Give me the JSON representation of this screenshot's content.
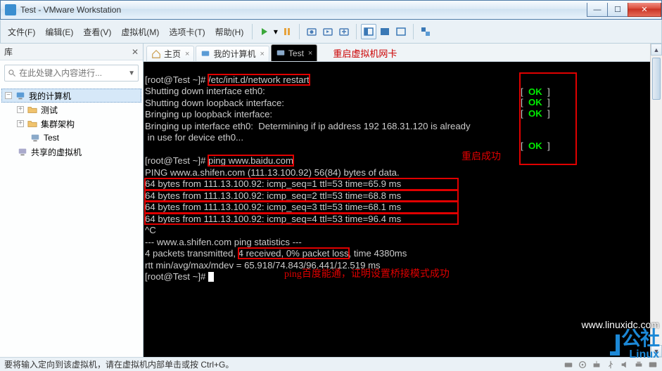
{
  "window": {
    "title": "Test - VMware Workstation"
  },
  "menu": {
    "file": "文件(F)",
    "edit": "编辑(E)",
    "view": "查看(V)",
    "vm": "虚拟机(M)",
    "tabs": "选项卡(T)",
    "help": "帮助(H)"
  },
  "sidebar": {
    "header": "库",
    "search_placeholder": "在此处键入内容进行...",
    "root": "我的计算机",
    "items": [
      {
        "label": "测试"
      },
      {
        "label": "集群架构"
      },
      {
        "label": "Test"
      }
    ],
    "shared": "共享的虚拟机"
  },
  "tabs": [
    {
      "label": "主页",
      "kind": "home"
    },
    {
      "label": "我的计算机",
      "kind": "pc"
    },
    {
      "label": "Test",
      "kind": "vm",
      "active": true
    }
  ],
  "annotations": {
    "restart": "重启虚拟机网卡",
    "ok": "重启成功",
    "ping": "ping百度能通，证明设置桥接模式成功"
  },
  "terminal": {
    "prompt1_user": "[root@Test ~]# ",
    "cmd1": "/etc/init.d/network restart",
    "l2": "Shutting down interface eth0:",
    "l3": "Shutting down loopback interface:",
    "l4": "Bringing up loopback interface:",
    "l5a": "Bringing up interface eth0:  Determining if ip address 192",
    "l5b": "168.31.120 is already",
    "l6": " in use for device eth0...",
    "ok": "OK",
    "prompt2_user": "[root@Test ~]# ",
    "cmd2": "ping www.baidu.com",
    "p0": "PING www.a.shifen.com (111.13.100.92) 56(84) bytes of data.",
    "p1": "64 bytes from 111.13.100.92: icmp_seq=1 ttl=53 time=65.9 ms",
    "p2": "64 bytes from 111.13.100.92: icmp_seq=2 ttl=53 time=68.8 ms",
    "p3": "64 bytes from 111.13.100.92: icmp_seq=3 ttl=53 time=68.1 ms",
    "p4": "64 bytes from 111.13.100.92: icmp_seq=4 ttl=53 time=96.4 ms",
    "ctrlc": "^C",
    "s1": "--- www.a.shifen.com ping statistics ---",
    "s2a": "4 packets transmitted, ",
    "s2b": "4 received, 0% packet loss",
    "s2c": ", time 4380ms",
    "s3": "rtt min/avg/max/mdev = 65.918/74.843/96.441/12.519 ms",
    "prompt3": "[root@Test ~]# "
  },
  "status": {
    "text": "要将输入定向到该虚拟机，请在虚拟机内部单击或按 Ctrl+G。"
  },
  "watermark": {
    "url": "www.linuxidc.com",
    "brand": "公社",
    "sub": "Linux"
  }
}
